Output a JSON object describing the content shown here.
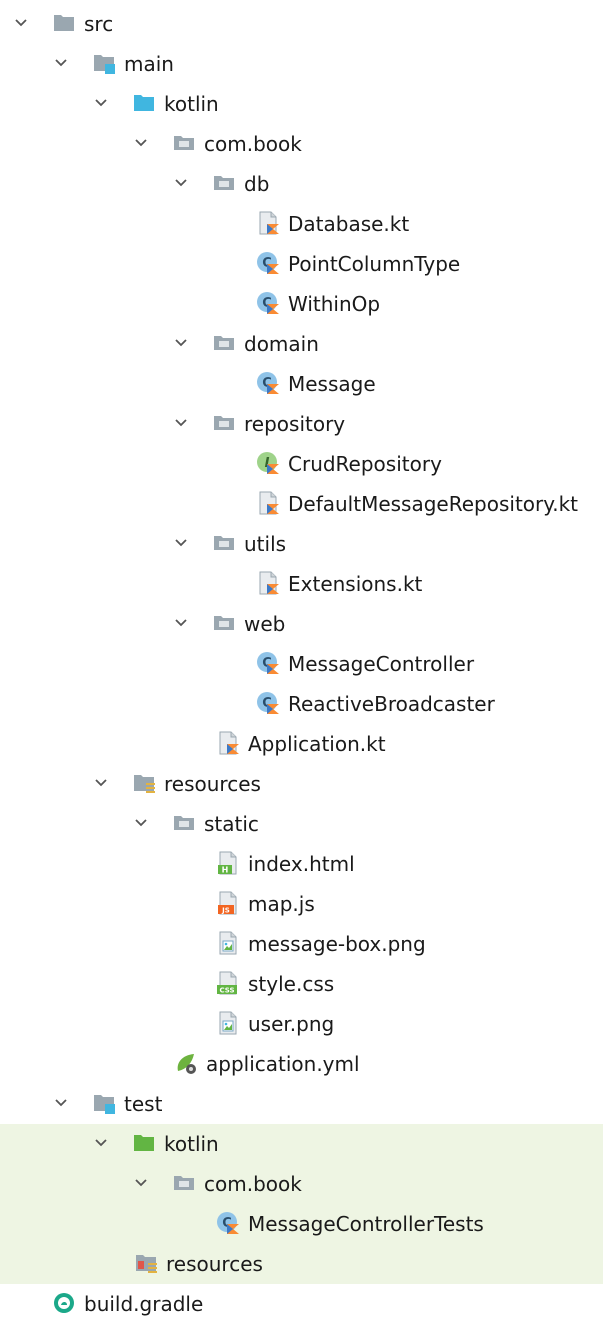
{
  "tree": {
    "items": [
      {
        "label": "src",
        "icon": "folder-icon",
        "expanded": true
      },
      {
        "label": "main",
        "icon": "source-set-folder-icon",
        "expanded": true
      },
      {
        "label": "kotlin",
        "icon": "source-root-folder-icon",
        "expanded": true
      },
      {
        "label": "com.book",
        "icon": "package-icon",
        "expanded": true
      },
      {
        "label": "db",
        "icon": "package-icon",
        "expanded": true
      },
      {
        "label": "Database.kt",
        "icon": "kotlin-file-icon"
      },
      {
        "label": "PointColumnType",
        "icon": "kotlin-class-icon"
      },
      {
        "label": "WithinOp",
        "icon": "kotlin-class-icon"
      },
      {
        "label": "domain",
        "icon": "package-icon",
        "expanded": true
      },
      {
        "label": "Message",
        "icon": "kotlin-class-icon"
      },
      {
        "label": "repository",
        "icon": "package-icon",
        "expanded": true
      },
      {
        "label": "CrudRepository",
        "icon": "kotlin-interface-icon"
      },
      {
        "label": "DefaultMessageRepository.kt",
        "icon": "kotlin-file-icon"
      },
      {
        "label": "utils",
        "icon": "package-icon",
        "expanded": true
      },
      {
        "label": "Extensions.kt",
        "icon": "kotlin-file-icon"
      },
      {
        "label": "web",
        "icon": "package-icon",
        "expanded": true
      },
      {
        "label": "MessageController",
        "icon": "kotlin-class-icon"
      },
      {
        "label": "ReactiveBroadcaster",
        "icon": "kotlin-class-icon"
      },
      {
        "label": "Application.kt",
        "icon": "kotlin-file-icon"
      },
      {
        "label": "resources",
        "icon": "resources-folder-icon",
        "expanded": true
      },
      {
        "label": "static",
        "icon": "package-icon",
        "expanded": true
      },
      {
        "label": "index.html",
        "icon": "html-file-icon",
        "badge": "H"
      },
      {
        "label": "map.js",
        "icon": "js-file-icon",
        "badge": "JS"
      },
      {
        "label": "message-box.png",
        "icon": "image-file-icon"
      },
      {
        "label": "style.css",
        "icon": "css-file-icon",
        "badge": "CSS"
      },
      {
        "label": "user.png",
        "icon": "image-file-icon"
      },
      {
        "label": "application.yml",
        "icon": "spring-config-icon"
      },
      {
        "label": "test",
        "icon": "source-set-folder-icon",
        "expanded": true
      },
      {
        "label": "kotlin",
        "icon": "test-root-folder-icon",
        "expanded": true
      },
      {
        "label": "com.book",
        "icon": "package-icon",
        "expanded": true
      },
      {
        "label": "MessageControllerTests",
        "icon": "kotlin-class-icon"
      },
      {
        "label": "resources",
        "icon": "test-resources-folder-icon"
      },
      {
        "label": "build.gradle",
        "icon": "gradle-icon"
      }
    ]
  },
  "colors": {
    "highlight": "#eef5e3",
    "folder_gray": "#9aa7b0",
    "source_blue": "#40b6e0",
    "test_green": "#62b543",
    "kotlin_orange": "#f98b34",
    "kotlin_blue": "#3c79c7"
  }
}
